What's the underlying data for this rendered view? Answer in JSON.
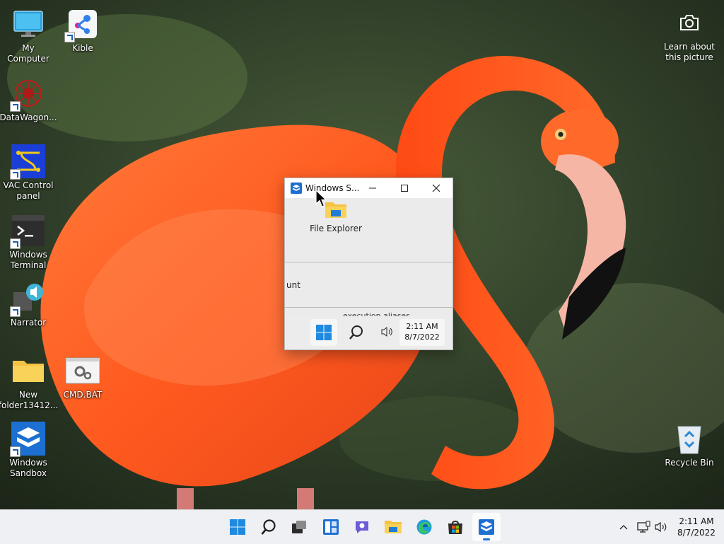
{
  "desktop": {
    "icons": [
      {
        "label": "My Computer"
      },
      {
        "label": "Kible"
      },
      {
        "label": "DataWagon..."
      },
      {
        "label": "VAC Control panel"
      },
      {
        "label": "Windows Terminal"
      },
      {
        "label": "Narrator"
      },
      {
        "label": "New folder13412..."
      },
      {
        "label": "CMD.BAT"
      },
      {
        "label": "Windows Sandbox"
      },
      {
        "label": "Recycle Bin"
      }
    ],
    "learn_about": "Learn about this picture"
  },
  "sandbox_window": {
    "title": "Windows S...",
    "file_explorer_label": "File Explorer",
    "partial_text": "unt",
    "partial_text2": "execution aliases",
    "inner_clock": {
      "time": "2:11 AM",
      "date": "8/7/2022"
    }
  },
  "taskbar": {
    "apps": [
      "start-icon",
      "search-icon",
      "task-view-icon",
      "widgets-icon",
      "chat-icon",
      "file-explorer-icon",
      "edge-icon",
      "store-icon",
      "windows-sandbox-icon"
    ],
    "clock": {
      "time": "2:11 AM",
      "date": "8/7/2022"
    }
  },
  "colors": {
    "accent": "#1f6fd6",
    "taskbar_bg": "#eef0f3",
    "wallpaper_flamingo": "#ff5a1f",
    "wallpaper_bg": "#2f3e2a"
  }
}
